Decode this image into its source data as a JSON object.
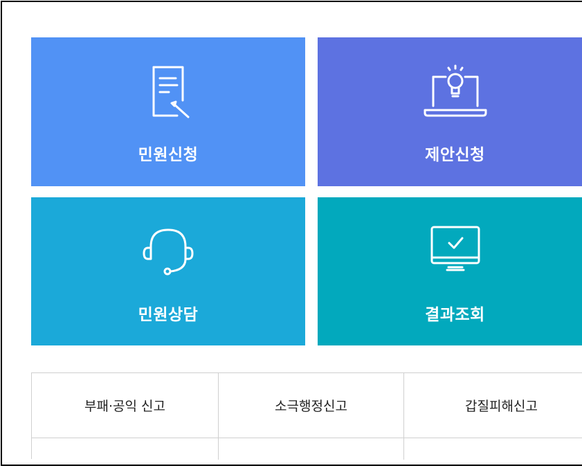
{
  "tiles": [
    {
      "label": "민원신청",
      "icon": "document-pen-icon",
      "color": "#5192f5"
    },
    {
      "label": "제안신청",
      "icon": "laptop-lightbulb-icon",
      "color": "#5d72e1"
    },
    {
      "label": "민원상담",
      "icon": "headset-icon",
      "color": "#1ba9d9"
    },
    {
      "label": "결과조회",
      "icon": "monitor-check-icon",
      "color": "#02a9bd"
    }
  ],
  "report_links": [
    {
      "label": "부패·공익 신고"
    },
    {
      "label": "소극행정신고"
    },
    {
      "label": "갑질피해신고"
    }
  ]
}
